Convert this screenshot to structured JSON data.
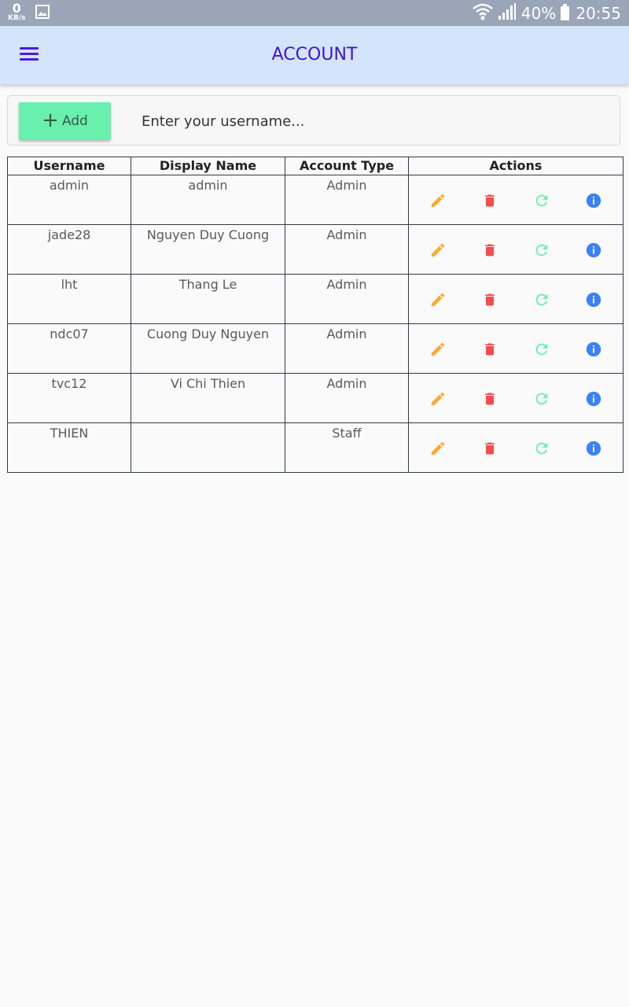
{
  "status_bar": {
    "net_speed": "0",
    "net_unit": "KB/s",
    "battery": "40%",
    "time": "20:55"
  },
  "app_bar": {
    "title": "ACCOUNT"
  },
  "toolbar": {
    "add_label": "Add",
    "search_placeholder": "Enter your username..."
  },
  "table": {
    "headers": [
      "Username",
      "Display Name",
      "Account Type",
      "Actions"
    ],
    "rows": [
      {
        "username": "admin",
        "display_name": "admin",
        "account_type": "Admin"
      },
      {
        "username": "jade28",
        "display_name": "Nguyen Duy Cuong",
        "account_type": "Admin"
      },
      {
        "username": "lht",
        "display_name": "Thang Le",
        "account_type": "Admin"
      },
      {
        "username": "ndc07",
        "display_name": "Cuong Duy Nguyen",
        "account_type": "Admin"
      },
      {
        "username": "tvc12",
        "display_name": "Vi Chi Thien",
        "account_type": "Admin"
      },
      {
        "username": "THIEN",
        "display_name": "",
        "account_type": "Staff"
      }
    ],
    "action_icons": [
      "edit-icon",
      "delete-icon",
      "reset-icon",
      "info-icon"
    ]
  },
  "colors": {
    "app_bar_bg": "#d4e5fb",
    "title": "#3d13d8",
    "add_button": "#69f0ae",
    "edit": "#ffa837",
    "delete": "#f44b4b",
    "reset": "#69f0ae",
    "info": "#3a82f7"
  }
}
